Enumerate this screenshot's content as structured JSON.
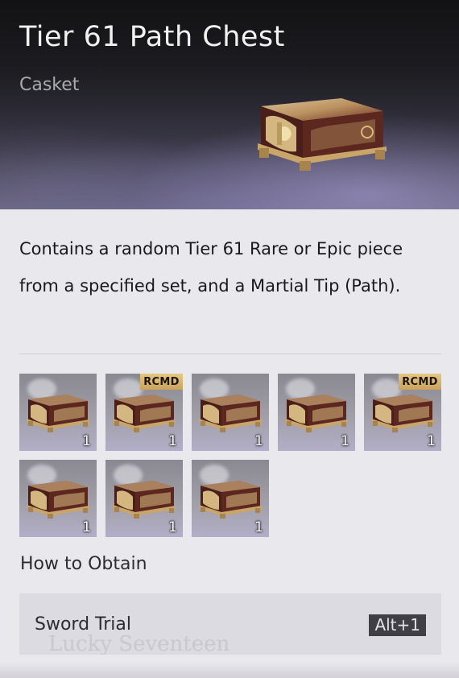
{
  "header": {
    "title": "Tier 61 Path Chest",
    "subtitle": "Casket"
  },
  "description": "Contains a random Tier 61 Rare or Epic piece from a specified set, and a Martial Tip (Path).",
  "items": [
    {
      "count": "1",
      "badge": "",
      "icon": "chest-icon"
    },
    {
      "count": "1",
      "badge": "RCMD",
      "icon": "chest-icon"
    },
    {
      "count": "1",
      "badge": "",
      "icon": "chest-icon"
    },
    {
      "count": "1",
      "badge": "",
      "icon": "chest-icon"
    },
    {
      "count": "1",
      "badge": "RCMD",
      "icon": "chest-icon"
    },
    {
      "count": "1",
      "badge": "",
      "icon": "chest-icon"
    },
    {
      "count": "1",
      "badge": "",
      "icon": "chest-icon"
    },
    {
      "count": "1",
      "badge": "",
      "icon": "chest-icon"
    }
  ],
  "obtain": {
    "title": "How to Obtain",
    "sources": [
      {
        "label": "Sword Trial",
        "hotkey": "Alt+1"
      }
    ],
    "watermark": "Lucky Seventeen"
  },
  "colors": {
    "badge": "#d9b870",
    "chest_wood": "#5a2a22",
    "chest_gold": "#e0c48a"
  }
}
